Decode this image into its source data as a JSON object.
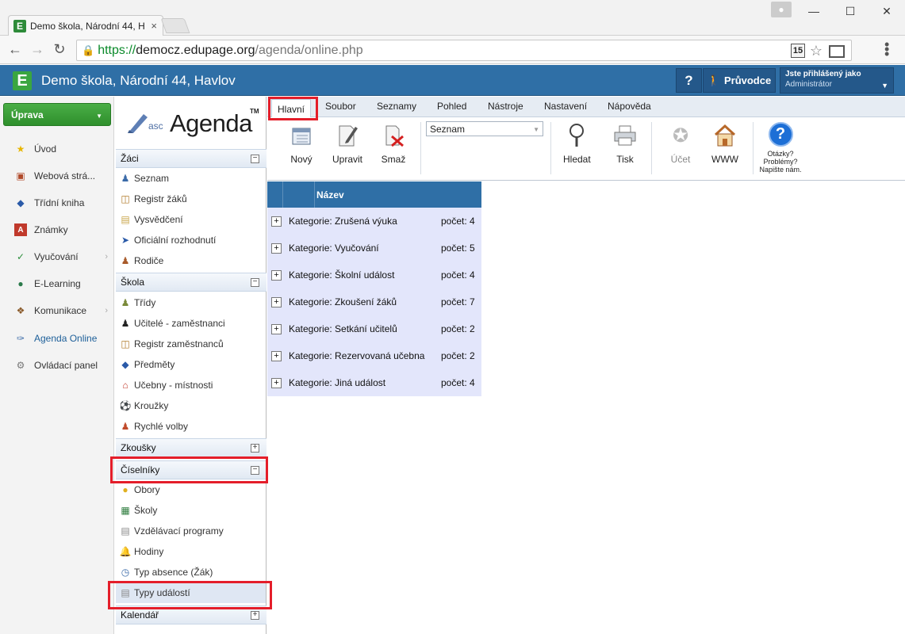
{
  "browser": {
    "tab_title": "Demo škola, Národní 44, H",
    "url_scheme": "https://",
    "url_host": "democz.edupage.org",
    "url_path": "/agenda/online.php",
    "ext_badge": "15"
  },
  "header": {
    "logo_letter": "E",
    "title": "Demo škola, Národní 44, Havlov",
    "help_label": "?",
    "guide_label": "Průvodce",
    "logged_as_label": "Jste přihlášený jako",
    "user_role": "Administrátor"
  },
  "leftnav": {
    "edit_button": "Úprava",
    "items": [
      {
        "label": "Úvod",
        "icon": "star-icon"
      },
      {
        "label": "Webová strá...",
        "icon": "website-icon"
      },
      {
        "label": "Třídní kniha",
        "icon": "book-icon"
      },
      {
        "label": "Známky",
        "icon": "grades-icon"
      },
      {
        "label": "Vyučování",
        "icon": "teaching-icon"
      },
      {
        "label": "E-Learning",
        "icon": "elearning-icon"
      },
      {
        "label": "Komunikace",
        "icon": "communication-icon"
      },
      {
        "label": "Agenda Online",
        "icon": "agenda-icon"
      },
      {
        "label": "Ovládací panel",
        "icon": "control-panel-icon"
      }
    ]
  },
  "agenda": {
    "logo_asc": "asc",
    "logo_agenda": "Agenda",
    "logo_tm": "TM",
    "sections": {
      "zaci": {
        "title": "Žáci",
        "toggle": "−",
        "items": [
          "Seznam",
          "Registr žáků",
          "Vysvědčení",
          "Oficiální rozhodnutí",
          "Rodiče"
        ]
      },
      "skola": {
        "title": "Škola",
        "toggle": "−",
        "items": [
          "Třídy",
          "Učitelé - zaměstnanci",
          "Registr zaměstnanců",
          "Předměty",
          "Učebny - místnosti",
          "Kroužky",
          "Rychlé volby"
        ]
      },
      "zkousky": {
        "title": "Zkoušky",
        "toggle": "+"
      },
      "ciselniky": {
        "title": "Číselníky",
        "toggle": "−",
        "items": [
          "Obory",
          "Školy",
          "Vzdělávací programy",
          "Hodiny",
          "Typ absence (Žák)",
          "Typy událostí"
        ]
      },
      "kalendar": {
        "title": "Kalendář",
        "toggle": "+"
      }
    }
  },
  "ribbon": {
    "tabs": [
      "Hlavní",
      "Soubor",
      "Seznamy",
      "Pohled",
      "Nástroje",
      "Nastavení",
      "Nápověda"
    ],
    "buttons": {
      "new": "Nový",
      "edit": "Upravit",
      "delete": "Smaž",
      "search": "Hledat",
      "print": "Tisk",
      "account": "Účet",
      "www": "WWW"
    },
    "view_select": "Seznam",
    "help_text_1": "Otázky?",
    "help_text_2": "Problémy?",
    "help_text_3": "Napište nám."
  },
  "grid": {
    "column_name": "Název",
    "rows": [
      {
        "category": "Kategorie: Zrušená výuka",
        "count": "počet: 4"
      },
      {
        "category": "Kategorie: Vyučování",
        "count": "počet: 5"
      },
      {
        "category": "Kategorie: Školní událost",
        "count": "počet: 4"
      },
      {
        "category": "Kategorie: Zkoušení žáků",
        "count": "počet: 7"
      },
      {
        "category": "Kategorie: Setkání učitelů",
        "count": "počet: 2"
      },
      {
        "category": "Kategorie: Rezervovaná učebna",
        "count": "počet: 2"
      },
      {
        "category": "Kategorie: Jiná událost",
        "count": "počet: 4"
      }
    ]
  },
  "colors": {
    "app_header": "#2f6fa6",
    "highlight_box": "#e41e2a",
    "grid_row": "#e3e6fb",
    "edit_button": "#3a9f37"
  }
}
